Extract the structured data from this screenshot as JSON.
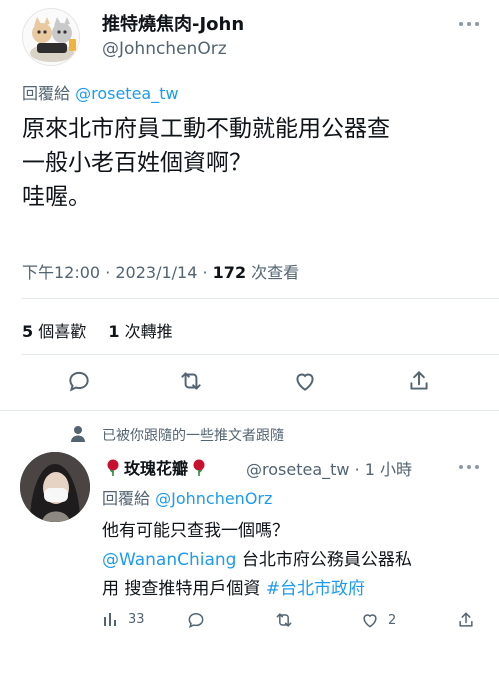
{
  "main_tweet": {
    "display_name": "推特燒焦肉-John",
    "handle": "@JohnchenOrz",
    "reply_prefix": "回覆給",
    "reply_to": "@rosetea_tw",
    "text_lines": [
      "原來北市府員工動不動就能用公器查",
      "一般小老百姓個資啊？",
      "哇喔。"
    ],
    "time": "下午12:00 · 2023/1/14 · ",
    "views_count": "172",
    "views_label": " 次查看",
    "likes_count": "5",
    "likes_label": " 個喜歡",
    "retweets_count": "1",
    "retweets_label": " 次轉推"
  },
  "followed_note": "已被你跟隨的一些推文者跟隨",
  "reply_tweet": {
    "display_name": "玫瑰花瓣",
    "handle_time": "@rosetea_tw · 1 小時",
    "reply_prefix": "回覆給",
    "reply_to": "@JohnchenOrz",
    "line1": "他有可能只查我一個嗎？",
    "mention": "@WananChiang",
    "line2_rest": "  台北市府公務員公器私",
    "line3_a": "用 搜查推特用戶個資 ",
    "hashtag": "#台北市政府",
    "views": "33",
    "likes": "2"
  },
  "colors": {
    "accent": "#1d9bf0",
    "secondary_text": "#536471"
  }
}
